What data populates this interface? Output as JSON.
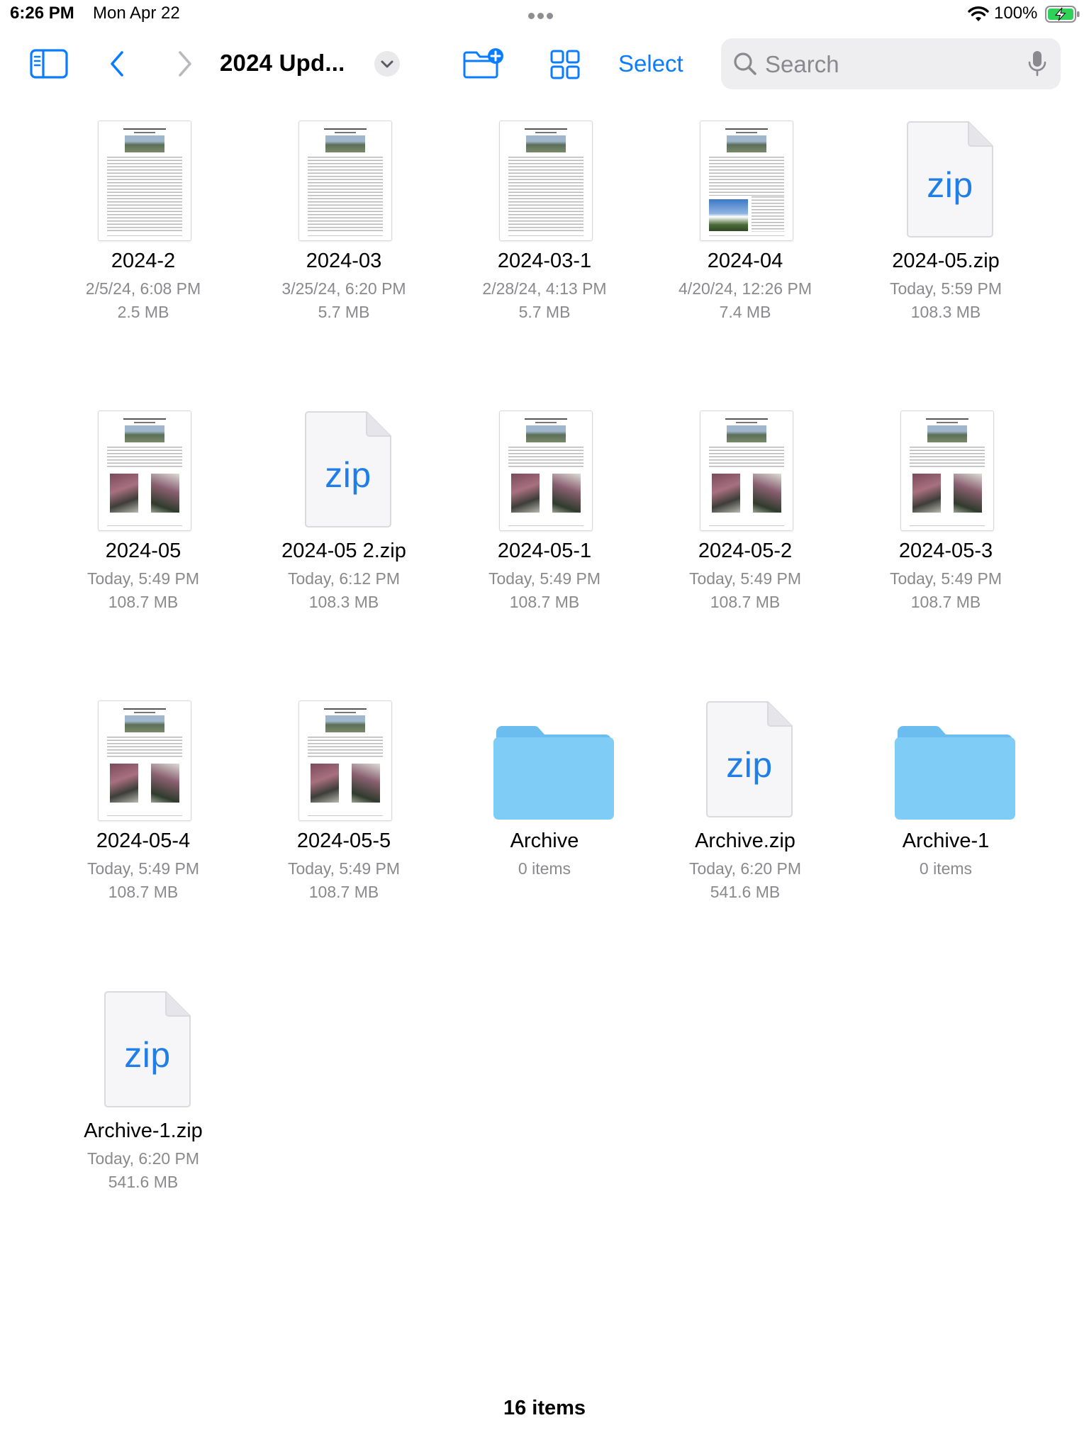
{
  "status_bar": {
    "time": "6:26 PM",
    "date": "Mon Apr 22",
    "battery_percent": "100%",
    "battery_color": "#30d158",
    "charging": true
  },
  "toolbar": {
    "title": "2024 Upd...",
    "select_label": "Select",
    "accent_color": "#0a7cff",
    "icons": [
      "sidebar-toggle-icon",
      "back-chevron-icon",
      "forward-chevron-icon",
      "title-menu-chevron-icon",
      "new-folder-icon",
      "icon-view-grid-icon"
    ]
  },
  "search": {
    "placeholder": "Search",
    "value": ""
  },
  "items": [
    {
      "name": "2024-2",
      "kind": "document",
      "thumb": "text",
      "date": "2/5/24, 6:08 PM",
      "size": "2.5 MB"
    },
    {
      "name": "2024-03",
      "kind": "document",
      "thumb": "text",
      "date": "3/25/24, 6:20 PM",
      "size": "5.7 MB"
    },
    {
      "name": "2024-03-1",
      "kind": "document",
      "thumb": "text",
      "date": "2/28/24, 4:13 PM",
      "size": "5.7 MB"
    },
    {
      "name": "2024-04",
      "kind": "document",
      "thumb": "landscape",
      "date": "4/20/24, 12:26 PM",
      "size": "7.4 MB"
    },
    {
      "name": "2024-05.zip",
      "kind": "zip",
      "zip_label": "zip",
      "date": "Today, 5:59 PM",
      "size": "108.3 MB"
    },
    {
      "name": "2024-05",
      "kind": "document",
      "thumb": "flowers",
      "date": "Today, 5:49 PM",
      "size": "108.7 MB"
    },
    {
      "name": "2024-05 2.zip",
      "kind": "zip",
      "zip_label": "zip",
      "date": "Today, 6:12 PM",
      "size": "108.3 MB"
    },
    {
      "name": "2024-05-1",
      "kind": "document",
      "thumb": "flowers",
      "date": "Today, 5:49 PM",
      "size": "108.7 MB"
    },
    {
      "name": "2024-05-2",
      "kind": "document",
      "thumb": "flowers",
      "date": "Today, 5:49 PM",
      "size": "108.7 MB"
    },
    {
      "name": "2024-05-3",
      "kind": "document",
      "thumb": "flowers",
      "date": "Today, 5:49 PM",
      "size": "108.7 MB"
    },
    {
      "name": "2024-05-4",
      "kind": "document",
      "thumb": "flowers",
      "date": "Today, 5:49 PM",
      "size": "108.7 MB"
    },
    {
      "name": "2024-05-5",
      "kind": "document",
      "thumb": "flowers",
      "date": "Today, 5:49 PM",
      "size": "108.7 MB"
    },
    {
      "name": "Archive",
      "kind": "folder",
      "count": "0 items"
    },
    {
      "name": "Archive.zip",
      "kind": "zip",
      "zip_label": "zip",
      "date": "Today, 6:20 PM",
      "size": "541.6 MB"
    },
    {
      "name": "Archive-1",
      "kind": "folder",
      "count": "0 items"
    },
    {
      "name": "Archive-1.zip",
      "kind": "zip",
      "zip_label": "zip",
      "date": "Today, 6:20 PM",
      "size": "541.6 MB"
    }
  ],
  "footer": {
    "item_count": "16 items"
  },
  "colors": {
    "folder_body": "#7fcdf6",
    "folder_tab": "#6bbdef",
    "zip_text": "#1f7ee8",
    "meta_text": "#8a8a8e"
  }
}
